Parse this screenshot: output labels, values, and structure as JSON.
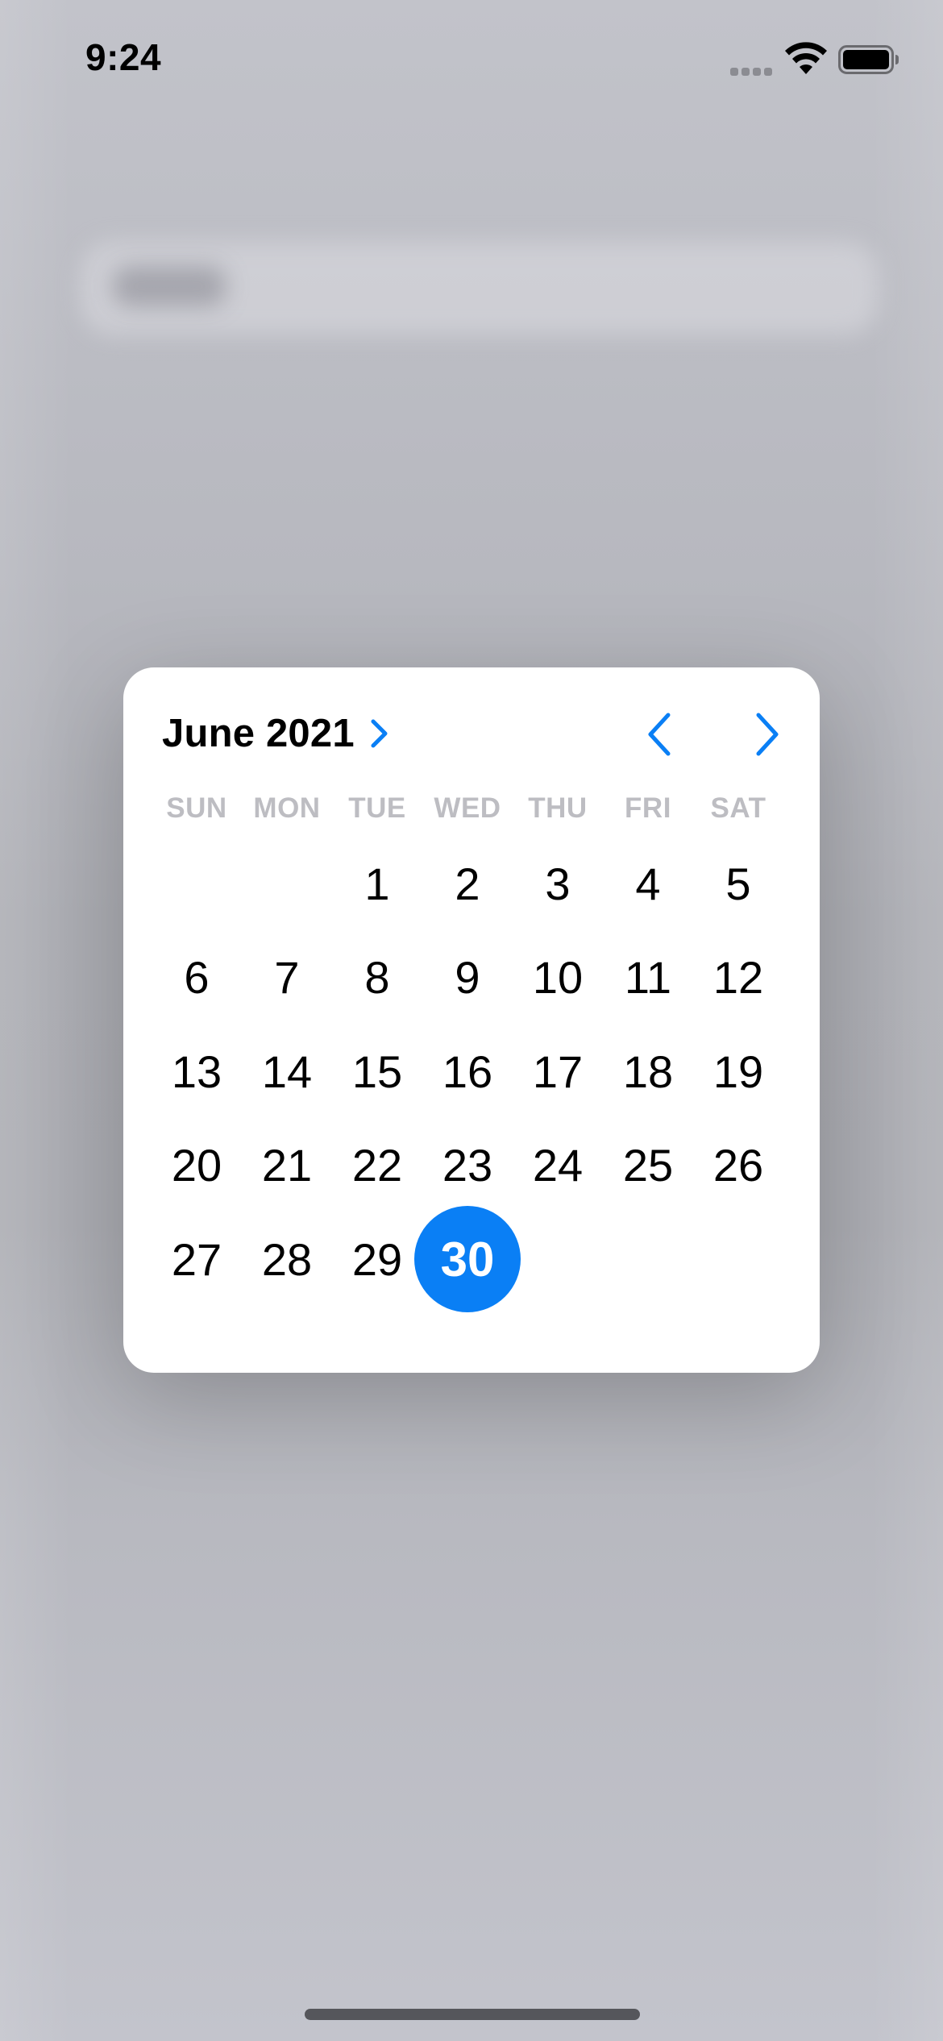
{
  "status_bar": {
    "time": "9:24",
    "icons": [
      "cellular-icon",
      "wifi-icon",
      "battery-icon"
    ]
  },
  "calendar": {
    "month_title": "June 2021",
    "weekdays": [
      "SUN",
      "MON",
      "TUE",
      "WED",
      "THU",
      "FRI",
      "SAT"
    ],
    "leading_empty": 2,
    "days": [
      "1",
      "2",
      "3",
      "4",
      "5",
      "6",
      "7",
      "8",
      "9",
      "10",
      "11",
      "12",
      "13",
      "14",
      "15",
      "16",
      "17",
      "18",
      "19",
      "20",
      "21",
      "22",
      "23",
      "24",
      "25",
      "26",
      "27",
      "28",
      "29",
      "30"
    ],
    "selected_day": "30",
    "icons": {
      "month_expand": "chevron-right-icon",
      "prev": "chevron-left-icon",
      "next": "chevron-right-icon"
    }
  },
  "colors": {
    "accent": "#0a7ff5",
    "weekday_text": "#bdbdc2",
    "card_bg": "#ffffff"
  }
}
